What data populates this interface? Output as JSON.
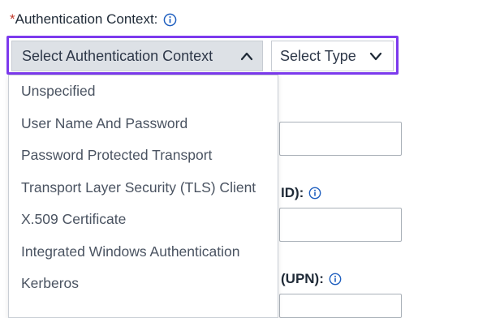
{
  "field": {
    "required_mark": "*",
    "label": "Authentication Context:"
  },
  "context_select": {
    "value": "Select Authentication Context",
    "state": "open"
  },
  "type_select": {
    "value": "Select Type"
  },
  "dropdown": {
    "options": [
      "Unspecified",
      "User Name And Password",
      "Password Protected Transport",
      "Transport Layer Security (TLS) Client",
      "X.509 Certificate",
      "Integrated Windows Authentication",
      "Kerberos"
    ]
  },
  "background_fields": {
    "label_1_tail": "ID):",
    "label_2_tail": "(UPN):"
  },
  "colors": {
    "highlight": "#7c3aed",
    "select_bg": "#dde1e6",
    "info_icon": "#1f5fbf"
  }
}
